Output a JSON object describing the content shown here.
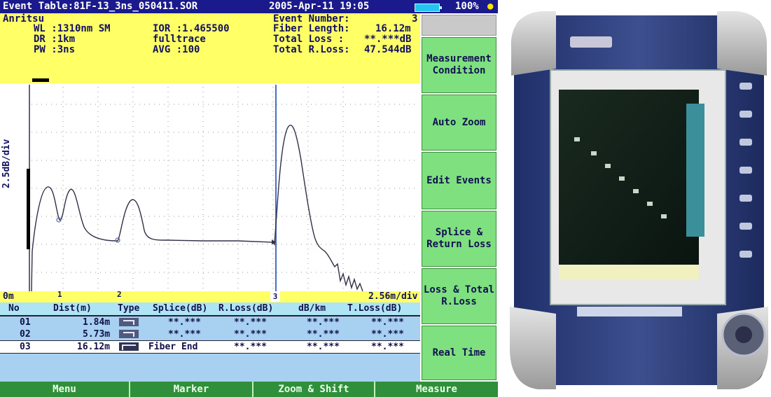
{
  "titlebar": {
    "file": "Event Table:81F-13_3ns_050411.SOR",
    "datetime": "2005-Apr-11 19:05",
    "battery": "100%"
  },
  "header": {
    "brand": "Anritsu",
    "wl": "WL :1310nm SM",
    "ior": "IOR :1.465500",
    "dr": "DR :1km",
    "mode": "fulltrace",
    "pw": "PW :3ns",
    "avg": "AVG :100",
    "event_number_label": "Event Number:",
    "event_number": "3",
    "fiber_length_label": "Fiber Length:",
    "fiber_length": "16.12m",
    "total_loss_label": "Total Loss  :",
    "total_loss": "**.***dB",
    "total_rloss_label": "Total R.Loss:",
    "total_rloss": "47.544dB"
  },
  "plot": {
    "ylabel": "2.5dB/div",
    "x_start": "0m",
    "x_scale": "2.56m/div",
    "markers": [
      "1",
      "2",
      "3"
    ]
  },
  "table": {
    "columns": [
      "No",
      "Dist(m)",
      "Type",
      "Splice(dB)",
      "R.Loss(dB)",
      "dB/km",
      "T.Loss(dB)"
    ],
    "rows": [
      {
        "no": "01",
        "dist": "1.84m",
        "type": "",
        "splice": "**.***",
        "rloss": "**.***",
        "dbkm": "**.***",
        "tloss": "**.***"
      },
      {
        "no": "02",
        "dist": "5.73m",
        "type": "",
        "splice": "**.***",
        "rloss": "**.***",
        "dbkm": "**.***",
        "tloss": "**.***"
      },
      {
        "no": "03",
        "dist": "16.12m",
        "type": "Fiber End",
        "splice": "",
        "rloss": "**.***",
        "dbkm": "**.***",
        "tloss": "**.***"
      }
    ]
  },
  "softkeys": [
    "Measurement Condition",
    "Auto Zoom",
    "Edit Events",
    "Splice & Return Loss",
    "Loss & Total R.Loss",
    "Real Time"
  ],
  "menubar": [
    "Menu",
    "Marker",
    "Zoom & Shift",
    "Measure"
  ],
  "colors": {
    "title_bg": "#1a1a8c",
    "header_bg": "#ffff66",
    "softkey_bg": "#7fe07f",
    "menubar_bg": "#2f8f3a",
    "table_bg": "#a8d0f0",
    "trace": "#303048",
    "cursor": "#4a70c0"
  }
}
